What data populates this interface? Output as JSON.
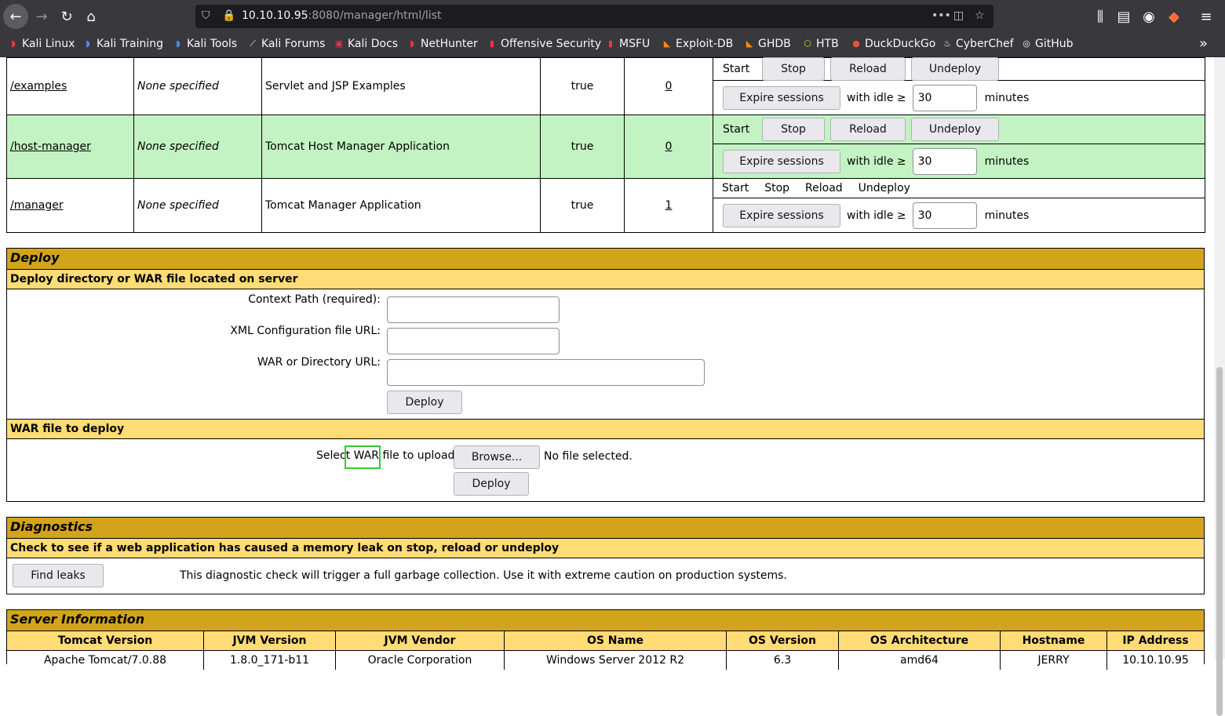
{
  "browser": {
    "url_host": "10.10.10.95",
    "url_rest": ":8080/manager/html/list",
    "bookmarks": [
      "Kali Linux",
      "Kali Training",
      "Kali Tools",
      "Kali Forums",
      "Kali Docs",
      "NetHunter",
      "Offensive Security",
      "MSFU",
      "Exploit-DB",
      "GHDB",
      "HTB",
      "DuckDuckGo",
      "CyberChef",
      "GitHub"
    ]
  },
  "apps": [
    {
      "path": "/examples",
      "version": "None specified",
      "display_name": "Servlet and JSP Examples",
      "running": "true",
      "sessions": "0",
      "highlight": false,
      "commands_as_buttons": true
    },
    {
      "path": "/host-manager",
      "version": "None specified",
      "display_name": "Tomcat Host Manager Application",
      "running": "true",
      "sessions": "0",
      "highlight": true,
      "commands_as_buttons": true
    },
    {
      "path": "/manager",
      "version": "None specified",
      "display_name": "Tomcat Manager Application",
      "running": "true",
      "sessions": "1",
      "highlight": false,
      "commands_as_buttons": false
    }
  ],
  "commands": {
    "start": "Start",
    "stop": "Stop",
    "reload": "Reload",
    "undeploy": "Undeploy",
    "expire": "Expire sessions",
    "with_idle": "with idle ≥",
    "idle_value": "30",
    "minutes": "minutes"
  },
  "deploy": {
    "title": "Deploy",
    "server_subtitle": "Deploy directory or WAR file located on server",
    "context_label": "Context Path (required):",
    "xml_label": "XML Configuration file URL:",
    "war_url_label": "WAR or Directory URL:",
    "deploy_button": "Deploy",
    "war_subtitle": "WAR file to deploy",
    "select_label": "Select WAR file to upload",
    "browse_button": "Browse...",
    "no_file": "No file selected.",
    "deploy_button2": "Deploy"
  },
  "diagnostics": {
    "title": "Diagnostics",
    "subtitle": "Check to see if a web application has caused a memory leak on stop, reload or undeploy",
    "find_leaks": "Find leaks",
    "note": "This diagnostic check will trigger a full garbage collection. Use it with extreme caution on production systems."
  },
  "server_info": {
    "title": "Server Information",
    "headers": [
      "Tomcat Version",
      "JVM Version",
      "JVM Vendor",
      "OS Name",
      "OS Version",
      "OS Architecture",
      "Hostname",
      "IP Address"
    ],
    "values": [
      "Apache Tomcat/7.0.88",
      "1.8.0_171-b11",
      "Oracle Corporation",
      "Windows Server 2012 R2",
      "6.3",
      "amd64",
      "JERRY",
      "10.10.10.95"
    ]
  },
  "colors": {
    "title_bg": "#d2a41c",
    "subtitle_bg": "#ffdc75",
    "highlight_row": "#c3f3c3",
    "focus_box": "#33cc33"
  }
}
